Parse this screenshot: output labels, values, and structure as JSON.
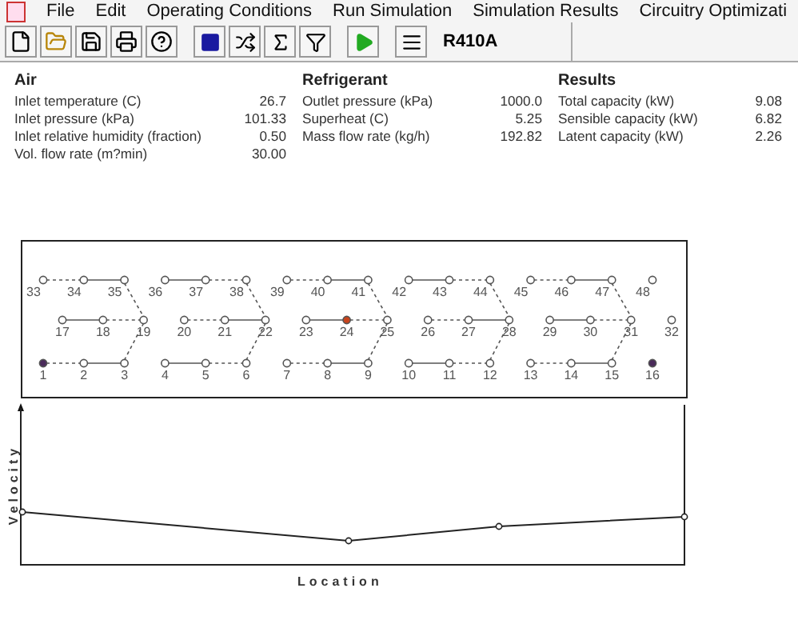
{
  "menu": [
    "File",
    "Edit",
    "Operating Conditions",
    "Run Simulation",
    "Simulation Results",
    "Circuitry Optimizati"
  ],
  "toolbar": {
    "refrigerant": "R410A"
  },
  "panels": [
    {
      "title": "Air",
      "rows": [
        {
          "label": "Inlet temperature (C)",
          "value": "26.7"
        },
        {
          "label": "Inlet pressure (kPa)",
          "value": "101.33"
        },
        {
          "label": "Inlet relative humidity (fraction)",
          "value": "0.50"
        },
        {
          "label": "Vol. flow rate (m?min)",
          "value": "30.00"
        }
      ]
    },
    {
      "title": "Refrigerant",
      "rows": [
        {
          "label": "Outlet pressure  (kPa)",
          "value": "1000.0"
        },
        {
          "label": "Superheat  (C)",
          "value": "5.25"
        },
        {
          "label": "Mass flow rate (kg/h)",
          "value": "192.82"
        }
      ]
    },
    {
      "title": "Results",
      "rows": [
        {
          "label": "Total capacity (kW)",
          "value": "9.08"
        },
        {
          "label": "Sensible capacity (kW)",
          "value": "6.82"
        },
        {
          "label": "Latent capacity (kW)",
          "value": "2.26"
        }
      ]
    }
  ],
  "circuit": {
    "rows": [
      {
        "nodes": [
          {
            "label": "33",
            "kind": "plain"
          },
          {
            "label": "34",
            "kind": "plain"
          },
          {
            "label": "35",
            "kind": "plain"
          },
          {
            "label": "36",
            "kind": "plain"
          },
          {
            "label": "37",
            "kind": "plain"
          },
          {
            "label": "38",
            "kind": "plain"
          },
          {
            "label": "39",
            "kind": "plain"
          },
          {
            "label": "40",
            "kind": "plain"
          },
          {
            "label": "41",
            "kind": "plain"
          },
          {
            "label": "42",
            "kind": "plain"
          },
          {
            "label": "43",
            "kind": "plain"
          },
          {
            "label": "44",
            "kind": "plain"
          },
          {
            "label": "45",
            "kind": "plain"
          },
          {
            "label": "46",
            "kind": "plain"
          },
          {
            "label": "47",
            "kind": "plain"
          },
          {
            "label": "48",
            "kind": "plain"
          }
        ]
      },
      {
        "nodes": [
          {
            "label": "17",
            "kind": "plain"
          },
          {
            "label": "18",
            "kind": "plain"
          },
          {
            "label": "19",
            "kind": "plain"
          },
          {
            "label": "20",
            "kind": "plain"
          },
          {
            "label": "21",
            "kind": "plain"
          },
          {
            "label": "22",
            "kind": "plain"
          },
          {
            "label": "23",
            "kind": "plain"
          },
          {
            "label": "24",
            "kind": "marked"
          },
          {
            "label": "25",
            "kind": "plain"
          },
          {
            "label": "26",
            "kind": "plain"
          },
          {
            "label": "27",
            "kind": "plain"
          },
          {
            "label": "28",
            "kind": "plain"
          },
          {
            "label": "29",
            "kind": "plain"
          },
          {
            "label": "30",
            "kind": "plain"
          },
          {
            "label": "31",
            "kind": "plain"
          },
          {
            "label": "32",
            "kind": "plain"
          }
        ]
      },
      {
        "nodes": [
          {
            "label": "1",
            "kind": "port"
          },
          {
            "label": "2",
            "kind": "plain"
          },
          {
            "label": "3",
            "kind": "plain"
          },
          {
            "label": "4",
            "kind": "plain"
          },
          {
            "label": "5",
            "kind": "plain"
          },
          {
            "label": "6",
            "kind": "plain"
          },
          {
            "label": "7",
            "kind": "plain"
          },
          {
            "label": "8",
            "kind": "plain"
          },
          {
            "label": "9",
            "kind": "plain"
          },
          {
            "label": "10",
            "kind": "plain"
          },
          {
            "label": "11",
            "kind": "plain"
          },
          {
            "label": "12",
            "kind": "plain"
          },
          {
            "label": "13",
            "kind": "plain"
          },
          {
            "label": "14",
            "kind": "plain"
          },
          {
            "label": "15",
            "kind": "plain"
          },
          {
            "label": "16",
            "kind": "port"
          }
        ]
      }
    ]
  },
  "velocity_chart": {
    "y_label": "Velocity",
    "x_label": "Location"
  }
}
